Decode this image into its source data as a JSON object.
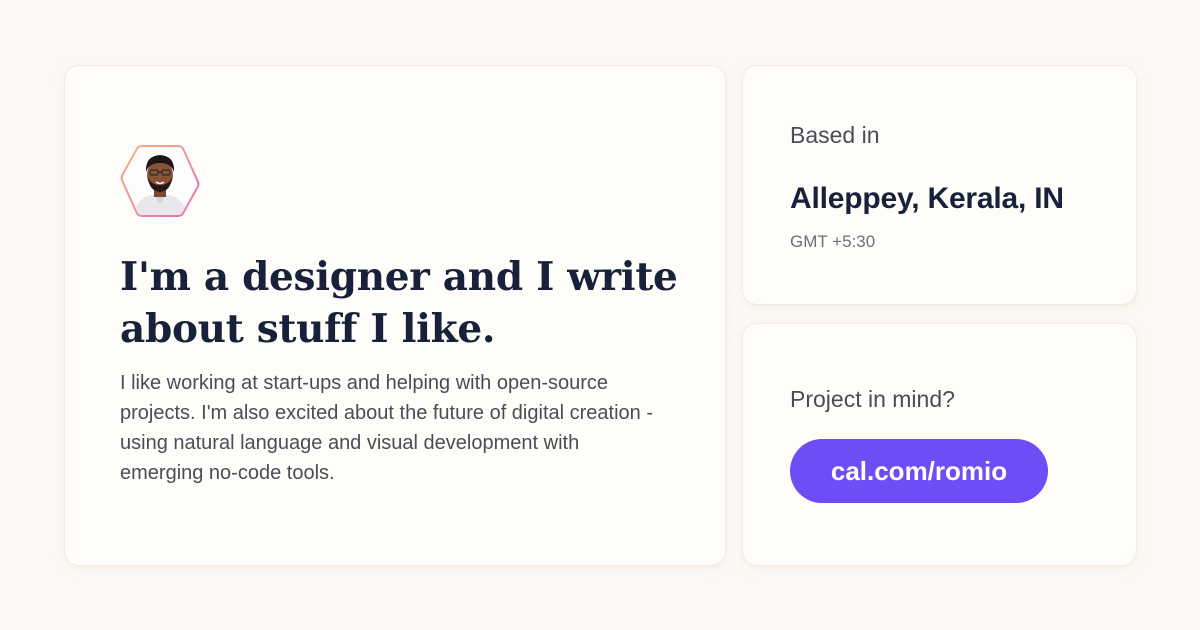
{
  "profile": {
    "headline": "I'm a designer and I write about stuff I like.",
    "bio": "I like working at start-ups and helping with open-source projects. I'm also excited about the future of digital creation - using natural language and visual development with emerging no-code tools.",
    "avatar_icon": "profile-photo"
  },
  "location": {
    "label": "Based in",
    "city": "Alleppey, Kerala, IN",
    "timezone": "GMT +5:30"
  },
  "project": {
    "label": "Project in mind?",
    "cta": "cal.com/romio"
  },
  "colors": {
    "background": "#fcf9f5",
    "card": "#fffdfa",
    "heading": "#17213a",
    "accent": "#6e4cf6"
  }
}
